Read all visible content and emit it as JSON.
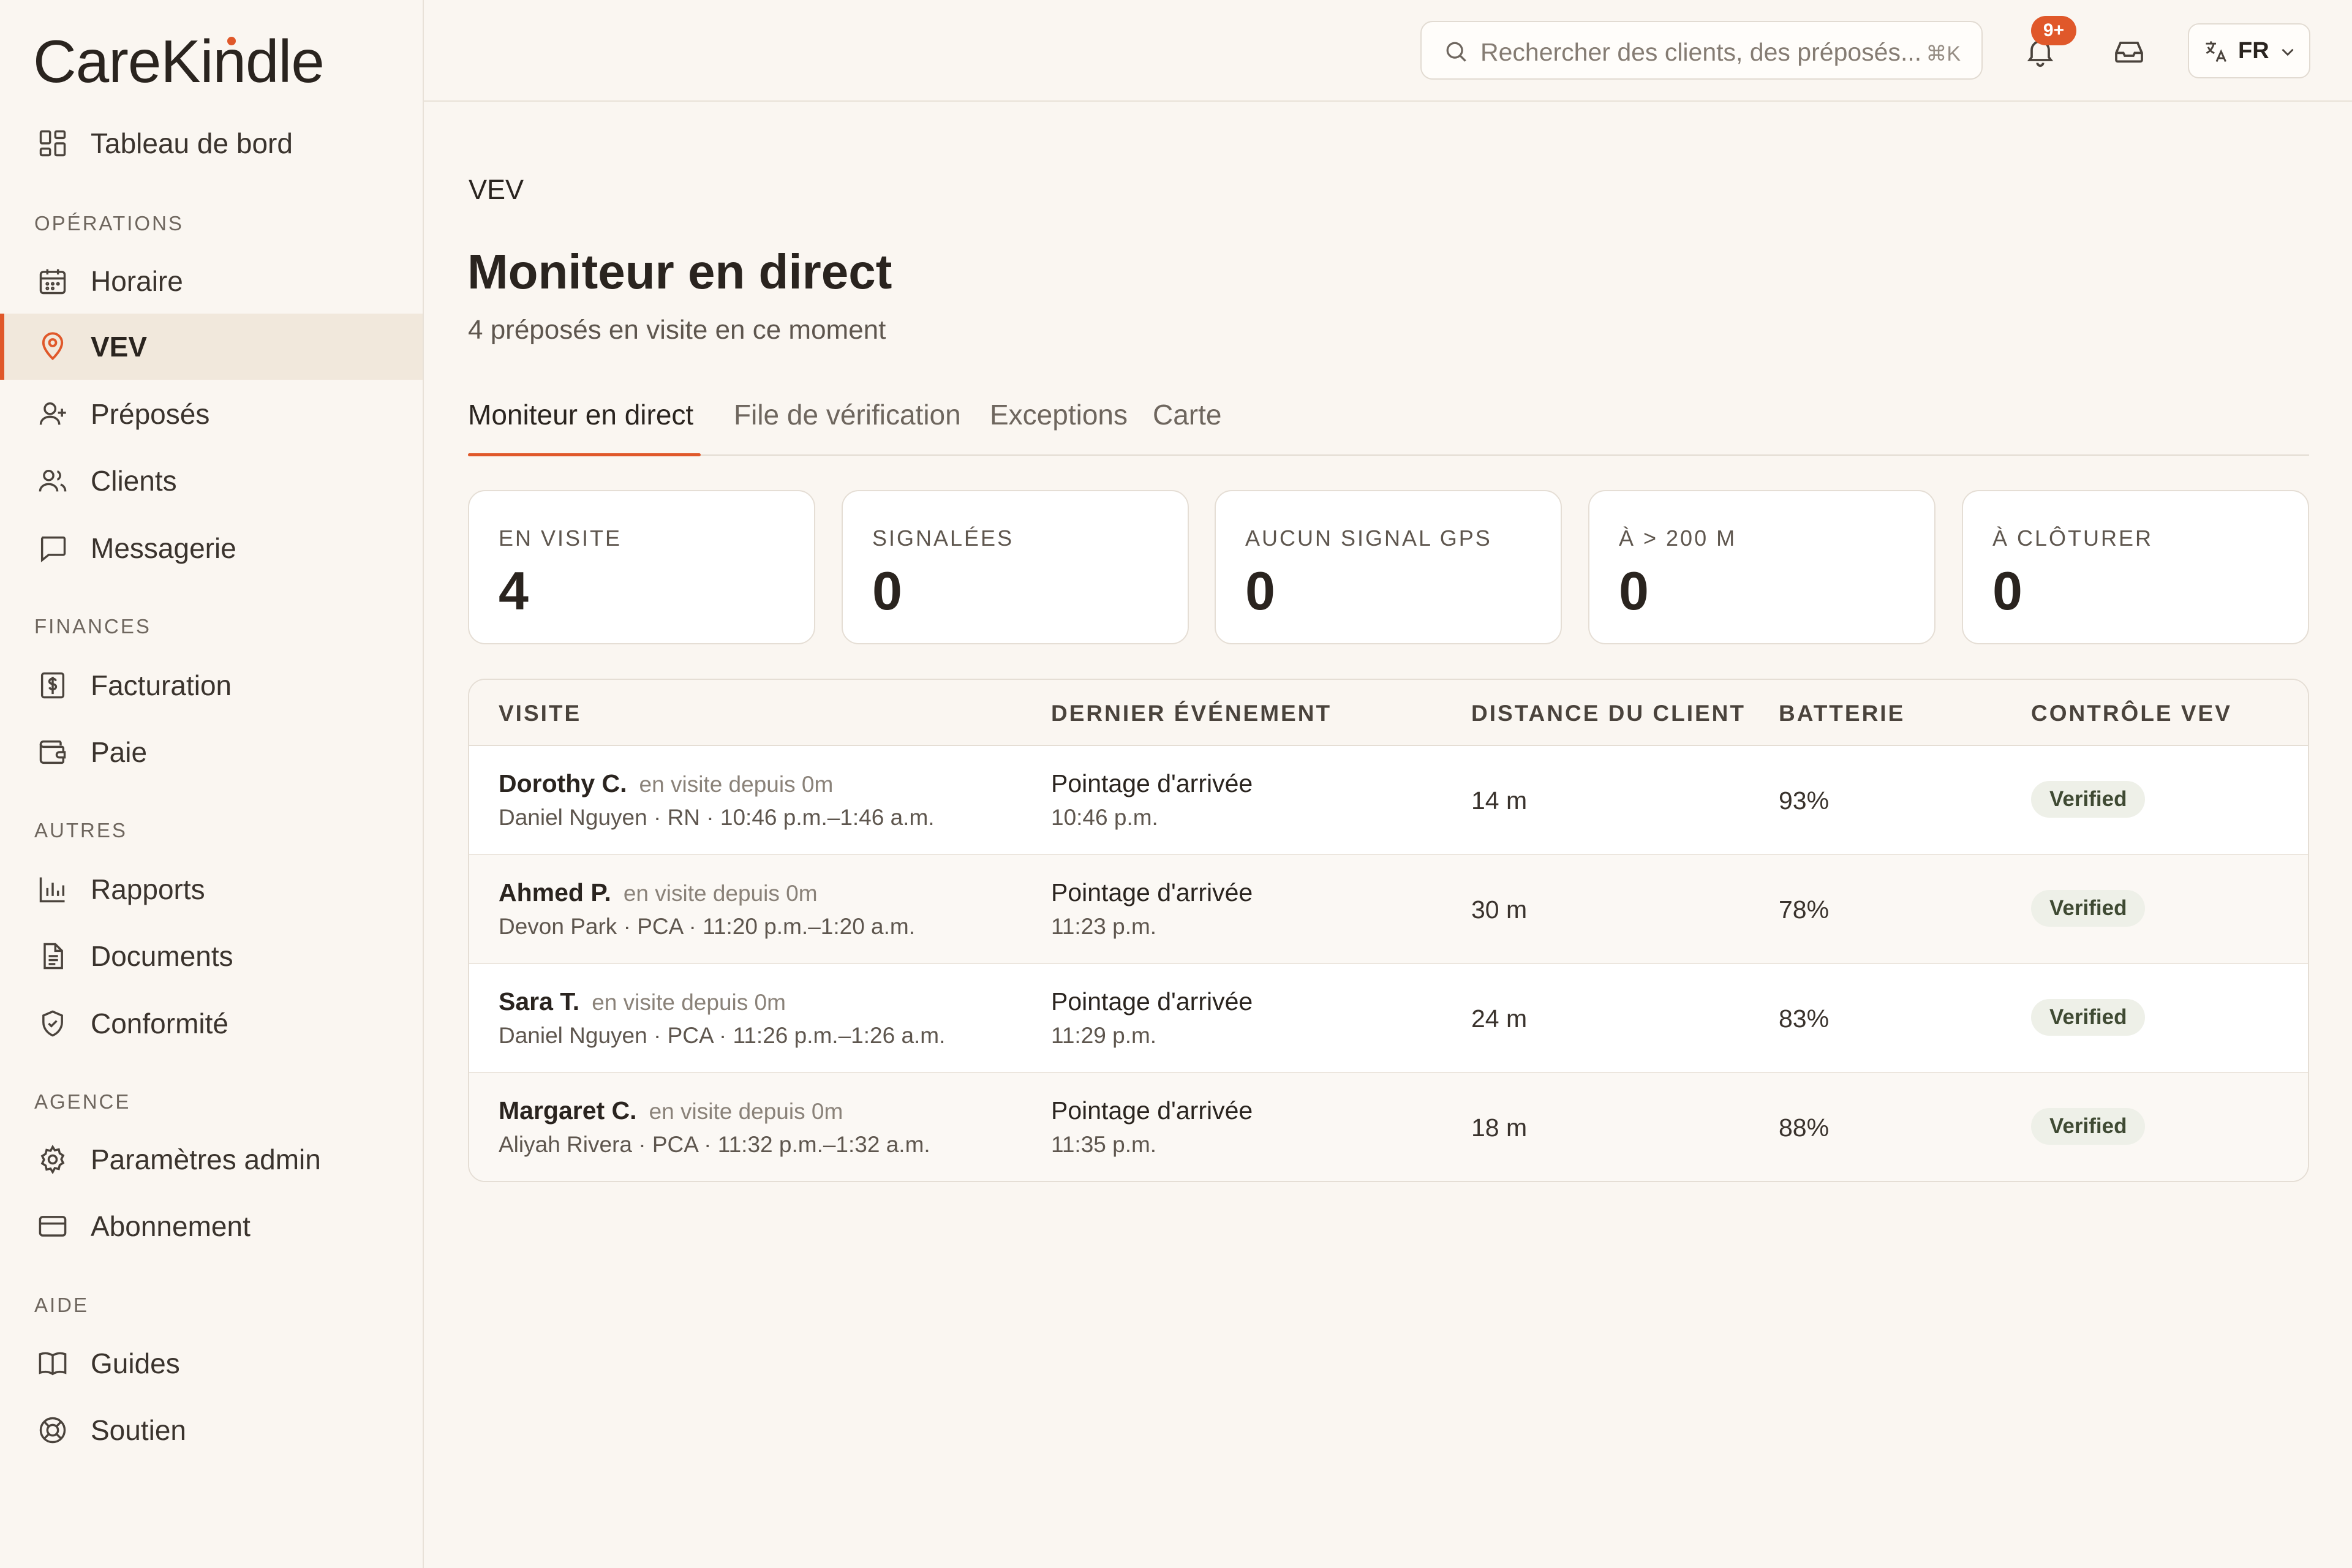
{
  "app": {
    "logo": "CareKindle"
  },
  "sidebar": {
    "top_item": {
      "label": "Tableau de bord",
      "icon": "dashboard-icon"
    },
    "sections": [
      {
        "title": "OPÉRATIONS",
        "items": [
          {
            "label": "Horaire",
            "icon": "calendar-icon"
          },
          {
            "label": "VEV",
            "icon": "map-pin-icon",
            "active": true
          },
          {
            "label": "Préposés",
            "icon": "user-plus-icon"
          },
          {
            "label": "Clients",
            "icon": "users-icon"
          },
          {
            "label": "Messagerie",
            "icon": "message-icon"
          }
        ]
      },
      {
        "title": "FINANCES",
        "items": [
          {
            "label": "Facturation",
            "icon": "invoice-icon"
          },
          {
            "label": "Paie",
            "icon": "wallet-icon"
          }
        ]
      },
      {
        "title": "AUTRES",
        "items": [
          {
            "label": "Rapports",
            "icon": "bar-chart-icon"
          },
          {
            "label": "Documents",
            "icon": "document-icon"
          },
          {
            "label": "Conformité",
            "icon": "shield-icon"
          }
        ]
      },
      {
        "title": "AGENCE",
        "items": [
          {
            "label": "Paramètres admin",
            "icon": "gear-icon"
          },
          {
            "label": "Abonnement",
            "icon": "credit-card-icon"
          }
        ]
      },
      {
        "title": "AIDE",
        "items": [
          {
            "label": "Guides",
            "icon": "book-icon"
          },
          {
            "label": "Soutien",
            "icon": "lifebuoy-icon"
          }
        ]
      }
    ]
  },
  "topbar": {
    "search_placeholder": "Rechercher des clients, des préposés...",
    "search_shortcut": "⌘K",
    "notifications_badge": "9+",
    "language": "FR"
  },
  "main": {
    "breadcrumb": "VEV",
    "title": "Moniteur en direct",
    "subtitle": "4 préposés en visite en ce moment",
    "tabs": [
      {
        "label": "Moniteur en direct",
        "active": true
      },
      {
        "label": "File de vérification"
      },
      {
        "label": "Exceptions"
      },
      {
        "label": "Carte"
      }
    ],
    "stats": [
      {
        "label": "EN VISITE",
        "value": "4"
      },
      {
        "label": "SIGNALÉES",
        "value": "0"
      },
      {
        "label": "AUCUN SIGNAL GPS",
        "value": "0"
      },
      {
        "label": "À > 200 M",
        "value": "0"
      },
      {
        "label": "À CLÔTURER",
        "value": "0"
      }
    ],
    "table": {
      "headers": [
        "VISITE",
        "DERNIER ÉVÉNEMENT",
        "DISTANCE DU CLIENT",
        "BATTERIE",
        "CONTRÔLE VEV"
      ],
      "rows": [
        {
          "client": "Dorothy C.",
          "since": "en visite depuis 0m",
          "details": "Daniel Nguyen · RN · 10:46 p.m.–1:46 a.m.",
          "event": "Pointage d'arrivée",
          "event_time": "10:46 p.m.",
          "distance": "14 m",
          "battery": "93%",
          "status": "Verified"
        },
        {
          "client": "Ahmed P.",
          "since": "en visite depuis 0m",
          "details": "Devon Park · PCA · 11:20 p.m.–1:20 a.m.",
          "event": "Pointage d'arrivée",
          "event_time": "11:23 p.m.",
          "distance": "30 m",
          "battery": "78%",
          "status": "Verified"
        },
        {
          "client": "Sara T.",
          "since": "en visite depuis 0m",
          "details": "Daniel Nguyen · PCA · 11:26 p.m.–1:26 a.m.",
          "event": "Pointage d'arrivée",
          "event_time": "11:29 p.m.",
          "distance": "24 m",
          "battery": "83%",
          "status": "Verified"
        },
        {
          "client": "Margaret C.",
          "since": "en visite depuis 0m",
          "details": "Aliyah Rivera · PCA · 11:32 p.m.–1:32 a.m.",
          "event": "Pointage d'arrivée",
          "event_time": "11:35 p.m.",
          "distance": "18 m",
          "battery": "88%",
          "status": "Verified"
        }
      ]
    }
  },
  "colors": {
    "accent": "#e0582a",
    "background": "#faf6f1",
    "verified_bg": "#eef0e8",
    "verified_text": "#3f4a33"
  }
}
